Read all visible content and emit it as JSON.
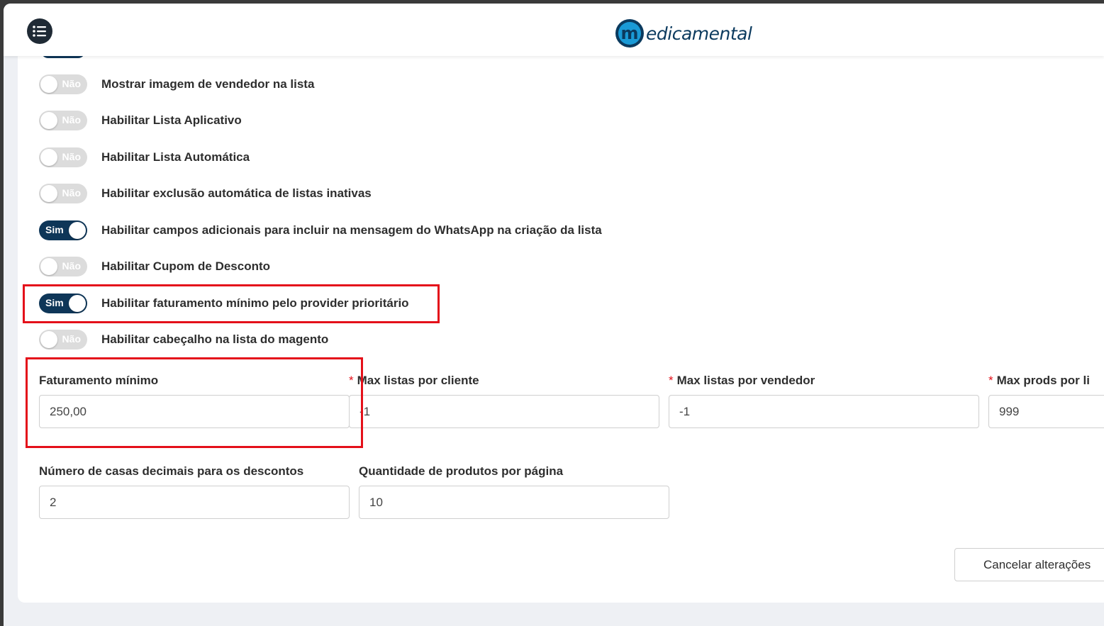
{
  "header": {
    "brand": "edicamental",
    "brand_mark": "m",
    "menu_icon": "list-icon"
  },
  "toggles": [
    {
      "label": "Mostrar imagem de vendedor na lista",
      "state": "Não",
      "on": false
    },
    {
      "label": "Habilitar Lista Aplicativo",
      "state": "Não",
      "on": false
    },
    {
      "label": "Habilitar Lista Automática",
      "state": "Não",
      "on": false
    },
    {
      "label": "Habilitar exclusão automática de listas inativas",
      "state": "Não",
      "on": false
    },
    {
      "label": "Habilitar campos adicionais para incluir na mensagem do WhatsApp na criação da lista",
      "state": "Sim",
      "on": true
    },
    {
      "label": "Habilitar Cupom de Desconto",
      "state": "Não",
      "on": false
    },
    {
      "label": "Habilitar faturamento mínimo pelo provider prioritário",
      "state": "Sim",
      "on": true
    },
    {
      "label": "Habilitar cabeçalho na lista do magento",
      "state": "Não",
      "on": false
    }
  ],
  "fields": [
    {
      "label": "Faturamento mínimo",
      "value": "250,00",
      "required": false
    },
    {
      "label": "Max listas por cliente",
      "value": "-1",
      "required": true
    },
    {
      "label": "Max listas por vendedor",
      "value": "-1",
      "required": true
    },
    {
      "label": "Max prods por li",
      "value": "999",
      "required": true
    },
    {
      "label": "Número de casas decimais para os descontos",
      "value": "2",
      "required": false
    },
    {
      "label": "Quantidade de produtos por página",
      "value": "10",
      "required": false
    }
  ],
  "actions": {
    "cancel": "Cancelar alterações"
  },
  "colors": {
    "toggle_on": "#0e3658",
    "toggle_off": "#dcdcdc",
    "highlight": "#e4101a",
    "required": "#e4101a"
  }
}
